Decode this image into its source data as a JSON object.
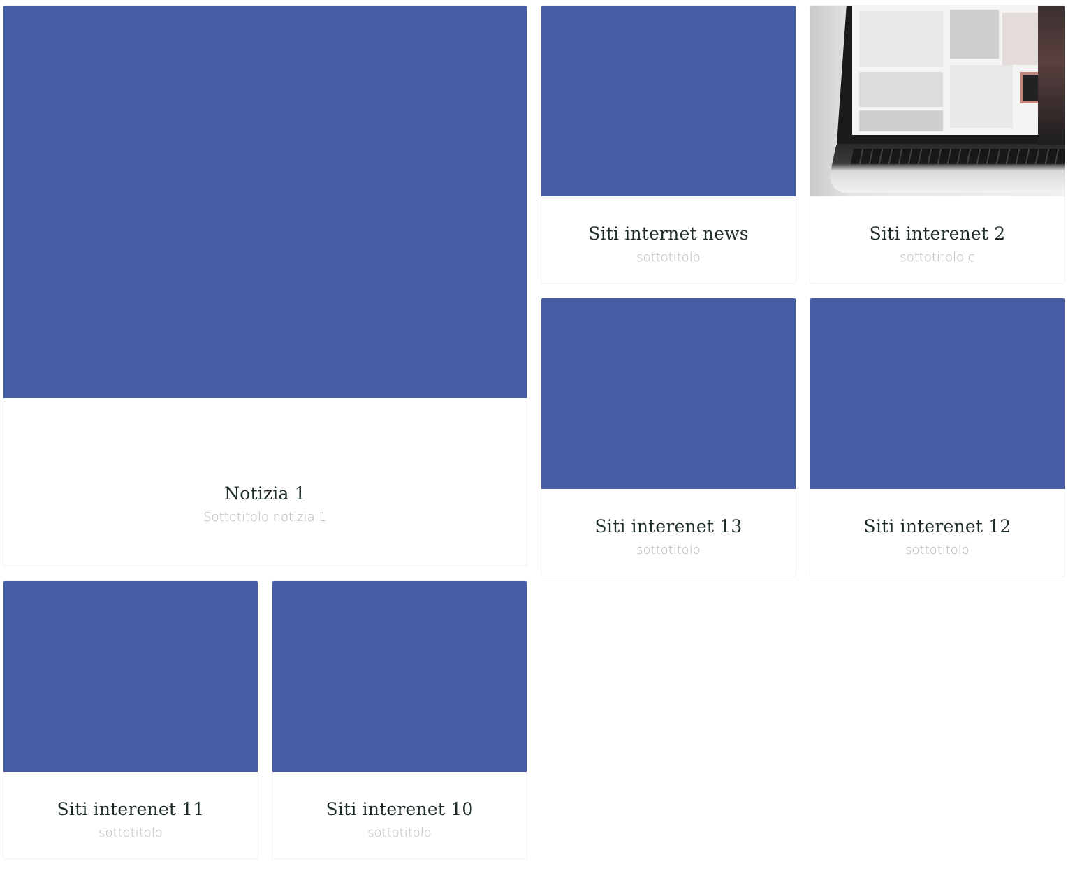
{
  "colors": {
    "placeholder_image": "#465da3",
    "title": "#1f2d2a",
    "subtitle": "#b3b6b8"
  },
  "cards": [
    {
      "title": "Notizia 1",
      "subtitle": "Sottotitolo notizia 1",
      "image": "placeholder"
    },
    {
      "title": "Siti internet news",
      "subtitle": "sottotitolo",
      "image": "placeholder"
    },
    {
      "title": "Siti interenet 2",
      "subtitle": "sottotitolo c",
      "image": "laptop-photo"
    },
    {
      "title": "Siti interenet 13",
      "subtitle": "sottotitolo",
      "image": "placeholder"
    },
    {
      "title": "Siti interenet 12",
      "subtitle": "sottotitolo",
      "image": "placeholder"
    },
    {
      "title": "Siti interenet 11",
      "subtitle": "sottotitolo",
      "image": "placeholder"
    },
    {
      "title": "Siti interenet 10",
      "subtitle": "sottotitolo",
      "image": "placeholder"
    }
  ]
}
